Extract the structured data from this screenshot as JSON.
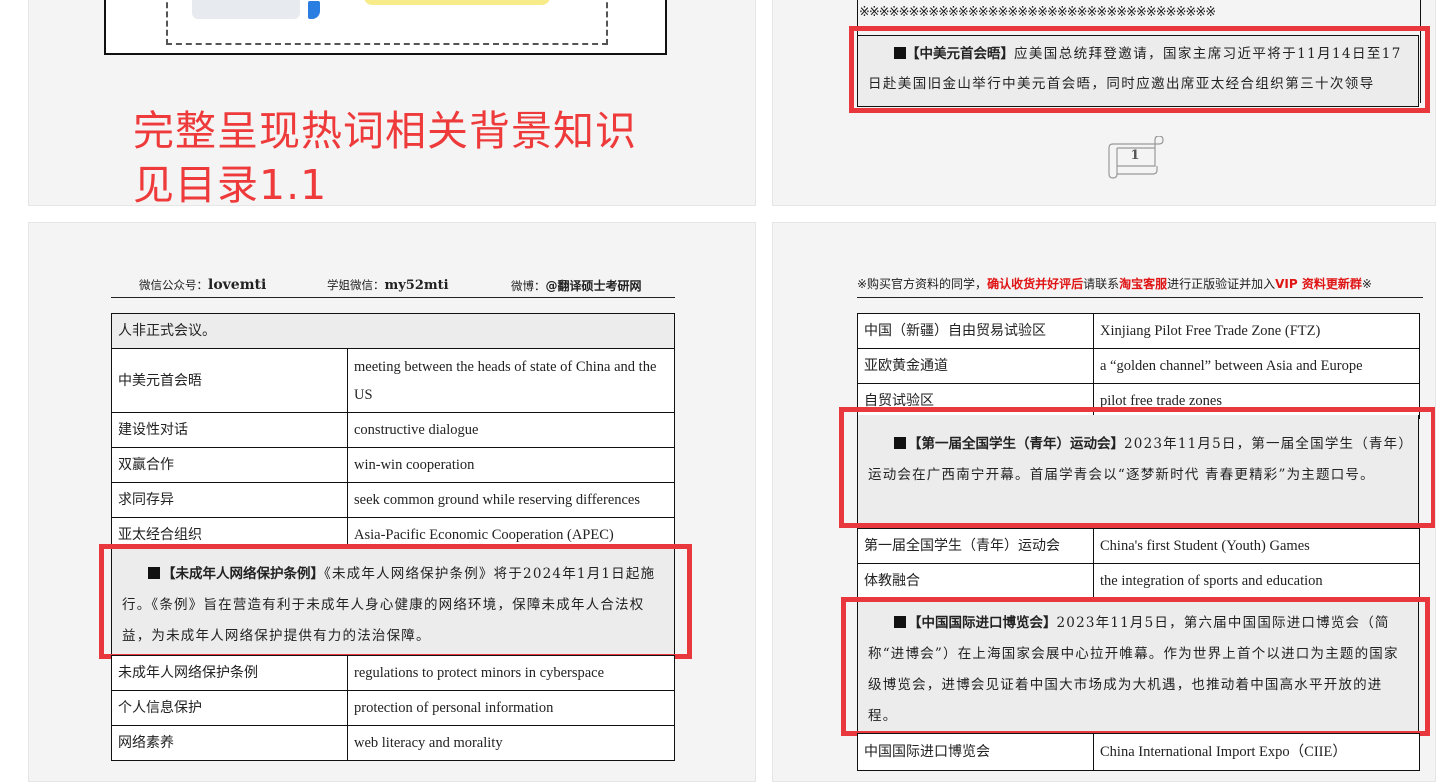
{
  "top_left": {
    "note_lines": [
      "完整呈现热词相关背景知识",
      "见目录1.1"
    ]
  },
  "top_right": {
    "symbols": "※※※※※※※※※※※※※※※※※※※※※※※※※※※※※※※※※※※※",
    "para_head": "【中美元首会晤】",
    "para_text": "应美国总统拜登邀请，国家主席习近平将于11月14日至17日赴美国旧金山举行中美元首会晤，同时应邀出席亚太经合组织第三十次领导",
    "page_number": "1"
  },
  "bottom_left": {
    "header": {
      "wechat_label": "微信公众号：",
      "wechat_value": "lovemti",
      "senior_label": "学姐微信：",
      "senior_value": "my52mti",
      "weibo_label": "微博：",
      "weibo_value": "@翻译硕士考研网"
    },
    "lead_row": "人非正式会议。",
    "rows_a": [
      {
        "cn": "中美元首会晤",
        "en": "meeting between the heads of state of China and the US"
      },
      {
        "cn": "建设性对话",
        "en": "constructive dialogue"
      },
      {
        "cn": "双赢合作",
        "en": "win-win cooperation"
      },
      {
        "cn": "求同存异",
        "en": "seek common ground while reserving differences"
      },
      {
        "cn": "亚太经合组织",
        "en": "Asia-Pacific Economic Cooperation (APEC)"
      }
    ],
    "para_head": "【未成年人网络保护条例】",
    "para_text": "《未成年人网络保护条例》将于2024年1月1日起施行。《条例》旨在营造有利于未成年人身心健康的网络环境，保障未成年人合法权益，为未成年人网络保护提供有力的法治保障。",
    "rows_b": [
      {
        "cn": "未成年人网络保护条例",
        "en": "regulations to protect minors in cyberspace"
      },
      {
        "cn": "个人信息保护",
        "en": "protection of personal information"
      },
      {
        "cn": "网络素养",
        "en": "web literacy and morality"
      }
    ]
  },
  "bottom_right": {
    "notice": {
      "p1": "※购买官方资料的同学，",
      "p2": "确认收货并好评后",
      "p3": "请联系",
      "p4": "淘宝客服",
      "p5": "进行正版验证并加入",
      "p6": "VIP 资料更新群",
      "p7": "※"
    },
    "rows_a": [
      {
        "cn": "中国（新疆）自由贸易试验区",
        "en": "Xinjiang Pilot Free Trade Zone (FTZ)"
      },
      {
        "cn": "亚欧黄金通道",
        "en": "a “golden channel” between Asia and Europe"
      },
      {
        "cn": "自贸试验区",
        "en": "pilot free trade zones"
      }
    ],
    "para1_head": "【第一届全国学生（青年）运动会】",
    "para1_text": "2023年11月5日，第一届全国学生（青年）运动会在广西南宁开幕。首届学青会以“逐梦新时代 青春更精彩”为主题口号。",
    "rows_b": [
      {
        "cn": "第一届全国学生（青年）运动会",
        "en": "China's first Student (Youth) Games"
      },
      {
        "cn": "体教融合",
        "en": "the integration of sports and education"
      }
    ],
    "para2_head": "【中国国际进口博览会】",
    "para2_text": "2023年11月5日，第六届中国国际进口博览会（简称“进博会”）在上海国家会展中心拉开帷幕。作为世界上首个以进口为主题的国家级博览会，进博会见证着中国大市场成为大机遇，也推动着中国高水平开放的进程。",
    "rows_c": [
      {
        "cn": "中国国际进口博览会",
        "en": "China International Import Expo（CIIE）"
      }
    ]
  },
  "colors": {
    "highlight_red": "#e8383d",
    "note_red": "#ee3a3a",
    "page_bg": "#f4f4f4"
  }
}
